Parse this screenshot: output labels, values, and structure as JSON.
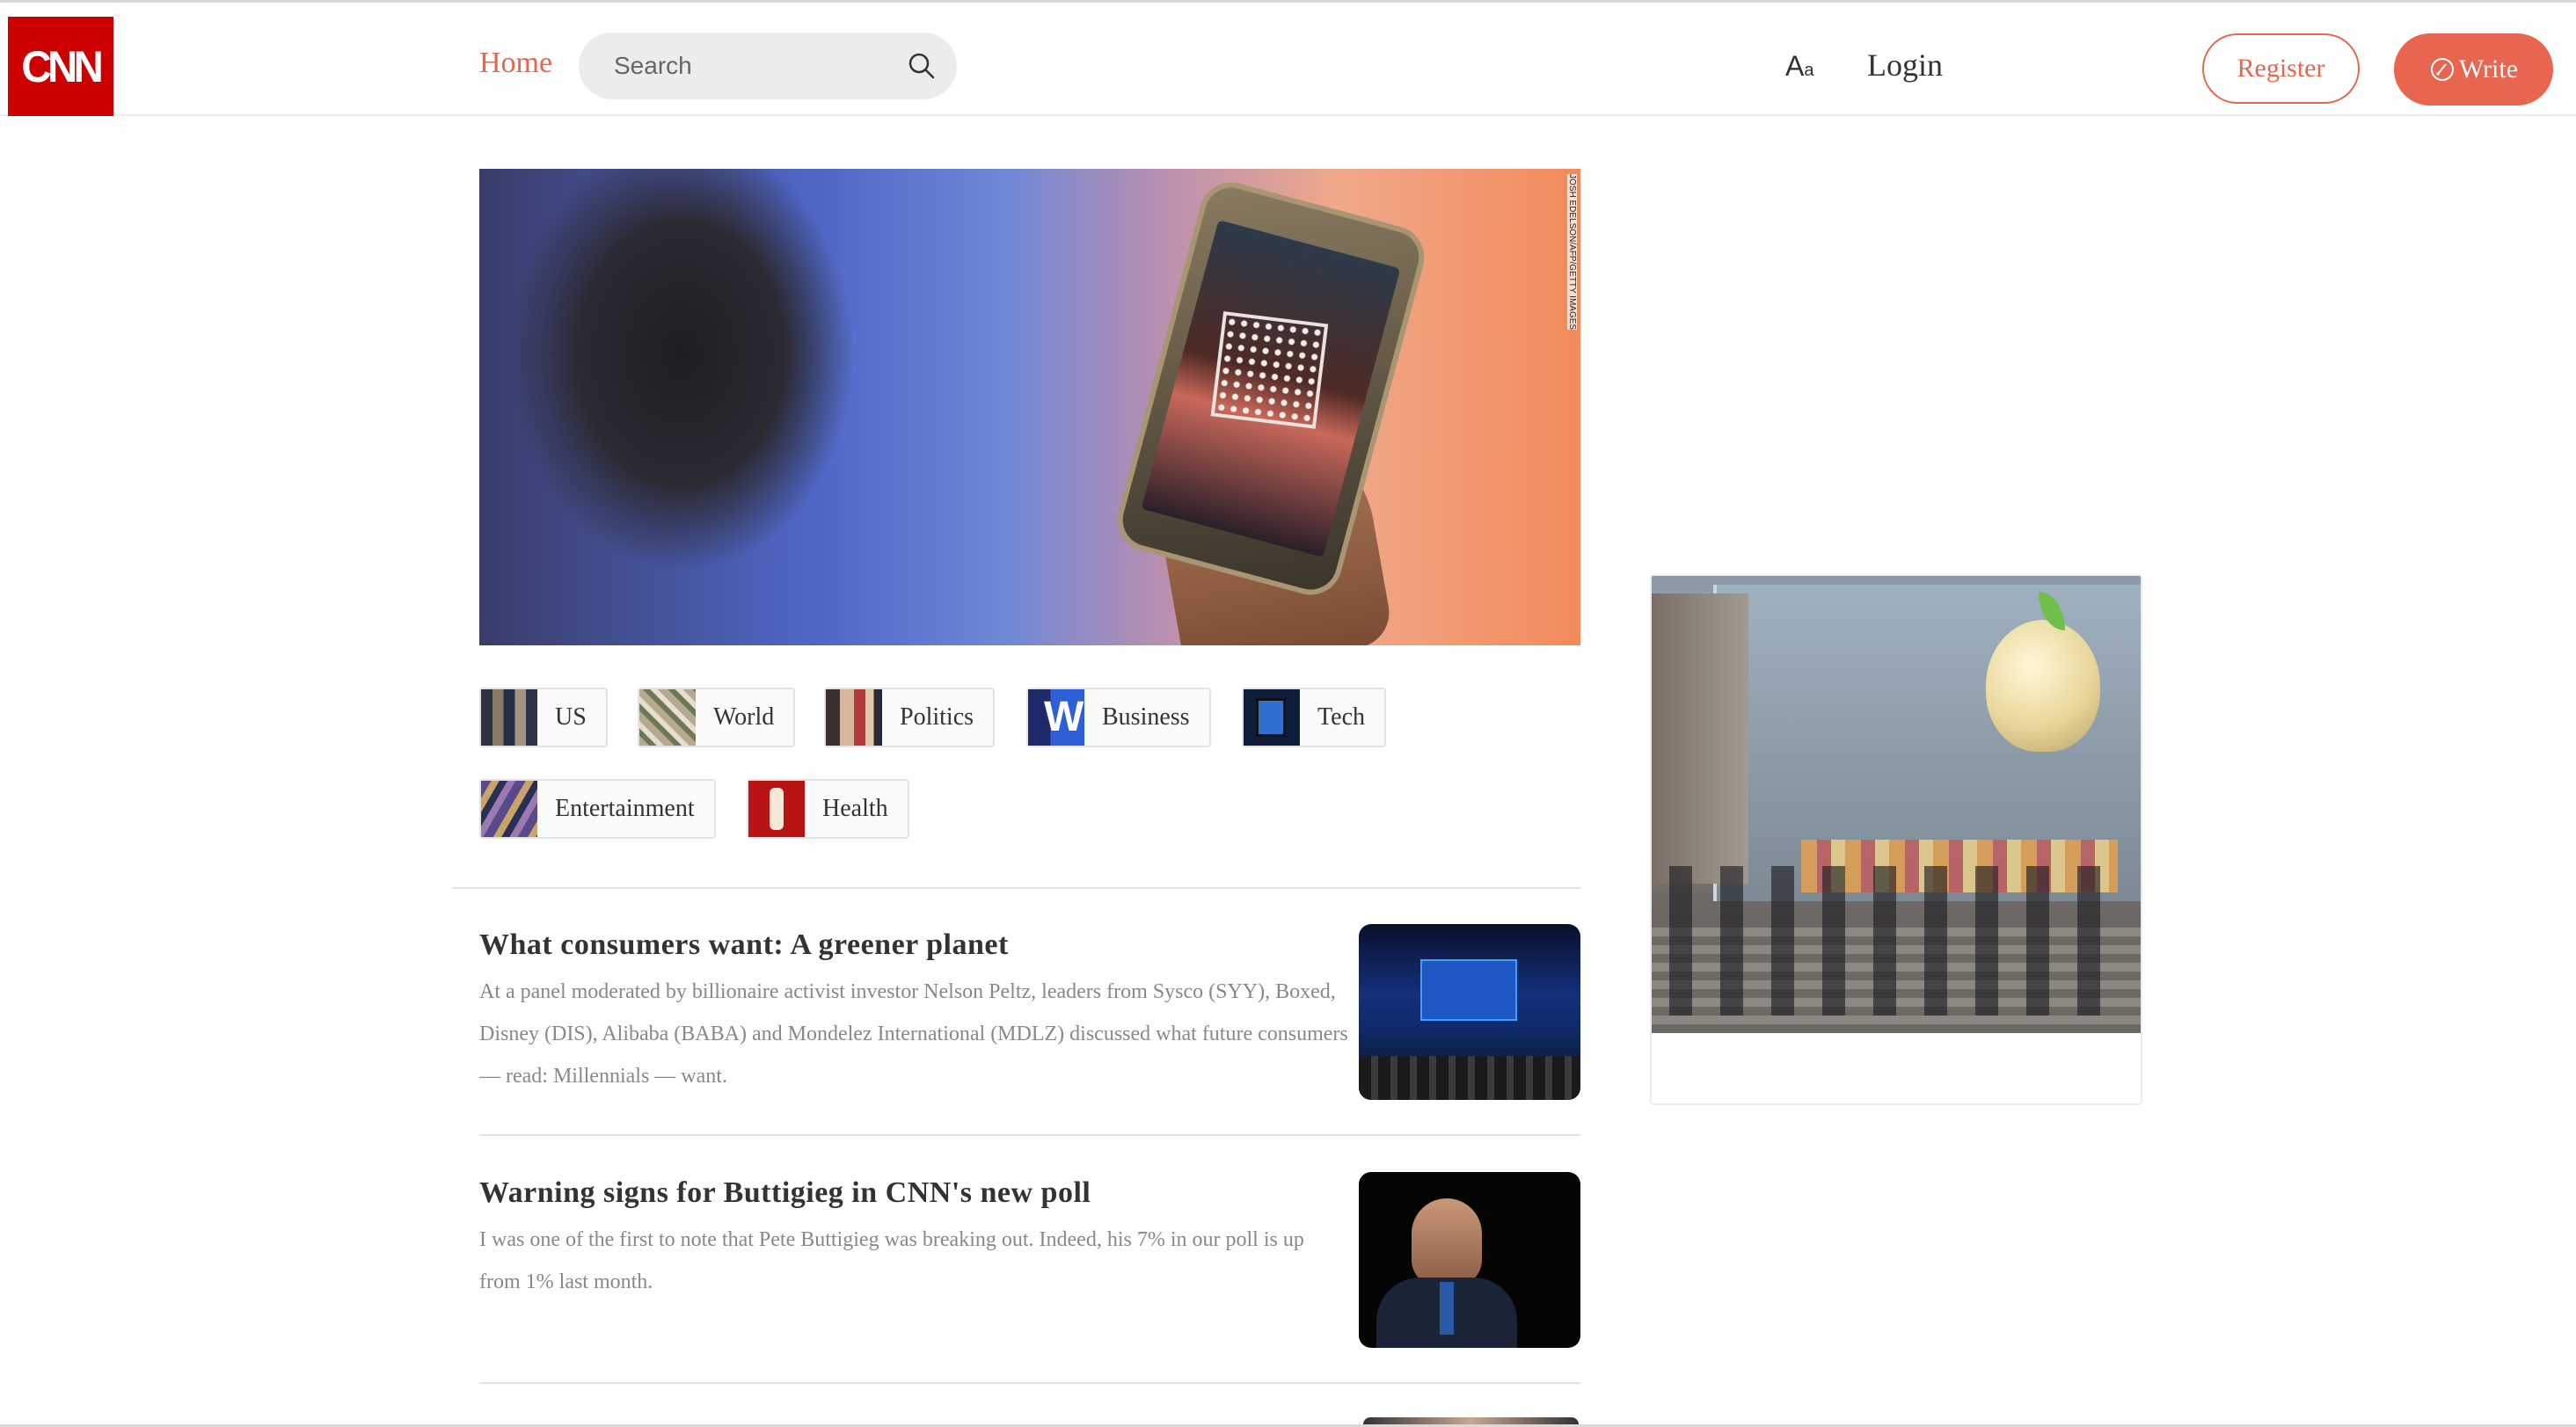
{
  "header": {
    "logo_text": "CNN",
    "home_label": "Home",
    "search_placeholder": "Search",
    "font_icon": "font-size-icon",
    "login_label": "Login",
    "register_label": "Register",
    "write_label": "Write",
    "brand_color": "#e8654f",
    "logo_color": "#cc0000"
  },
  "hero": {
    "credit": "JOSH EDELSON/AFP/GETTY IMAGES"
  },
  "categories": [
    {
      "label": "US"
    },
    {
      "label": "World"
    },
    {
      "label": "Politics"
    },
    {
      "label": "Business"
    },
    {
      "label": "Tech"
    },
    {
      "label": "Entertainment"
    },
    {
      "label": "Health"
    }
  ],
  "articles": [
    {
      "title": "What consumers want: A greener planet",
      "description": "At a panel moderated by billionaire activist investor Nelson Peltz, leaders from Sysco (SYY), Boxed, Disney (DIS), Alibaba (BABA) and Mondelez International (MDLZ) discussed what future consumers — read: Millennials — want."
    },
    {
      "title": "Warning signs for Buttigieg in CNN's new poll",
      "description": "I was one of the first to note that Pete Buttigieg was breaking out. Indeed, his 7% in our poll is up from 1% last month."
    }
  ]
}
